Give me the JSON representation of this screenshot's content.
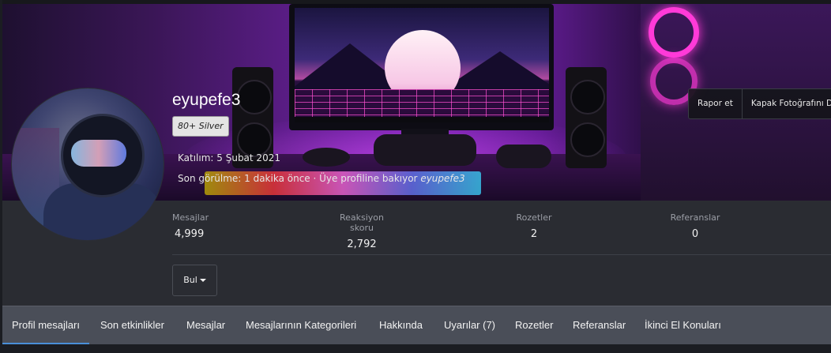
{
  "profile": {
    "username": "eyupefe3",
    "badge": "80+ Silver",
    "joined": "Katılım: 5 Şubat 2021",
    "last_seen_prefix": "Son görülme: 1 dakika önce · Üye profiline bakıyor ",
    "last_seen_user": "eyupefe3"
  },
  "cover_actions": {
    "report": "Rapor et",
    "cover_photo": "Kapak Fotoğrafını Düzenle"
  },
  "stats": [
    {
      "label": "Mesajlar",
      "value": "4,999"
    },
    {
      "label": "Reaksiyon skoru",
      "value": "2,792"
    },
    {
      "label": "Rozetler",
      "value": "2"
    },
    {
      "label": "Referanslar",
      "value": "0"
    }
  ],
  "find_button": "Bul",
  "tabs": [
    {
      "label": "Profil mesajları",
      "active": true
    },
    {
      "label": "Son etkinlikler"
    },
    {
      "label": "Mesajlar"
    },
    {
      "label": "Mesajlarının Kategorileri"
    },
    {
      "label": "Hakkında"
    },
    {
      "label": "Uyarılar (7)"
    },
    {
      "label": "Rozetler"
    },
    {
      "label": "Referanslar"
    },
    {
      "label": "İkinci El Konuları"
    }
  ],
  "colors": {
    "page_bg": "#1b1d22",
    "info_bg": "#2a2c32",
    "tabs_bg": "#4a4e58",
    "accent": "#4a8fd8"
  }
}
